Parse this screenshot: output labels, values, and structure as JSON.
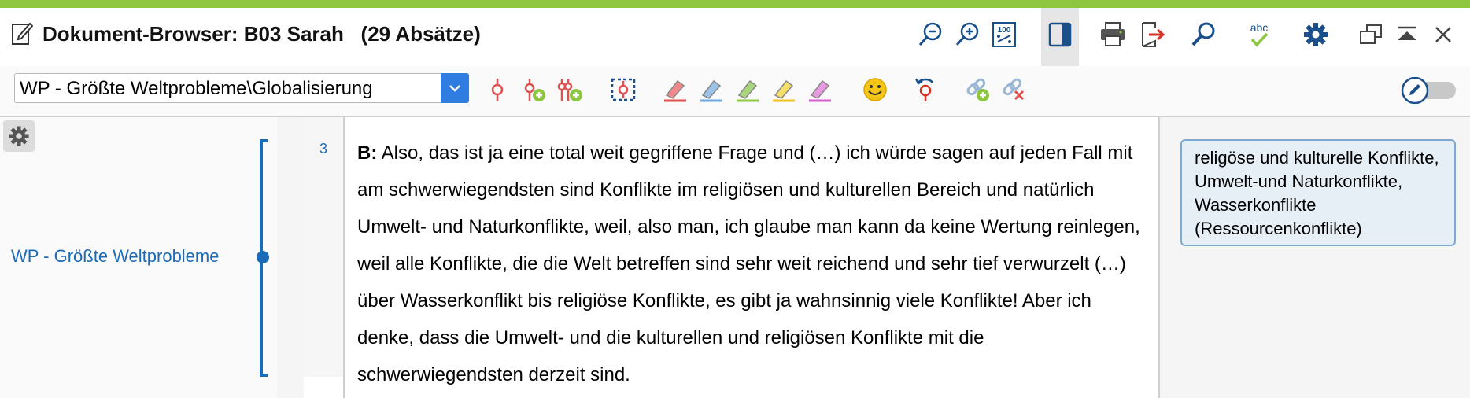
{
  "window": {
    "title": "Dokument-Browser: B03 Sarah   (29 Absätze)"
  },
  "colors": {
    "accent_green": "#8dc63f",
    "code_blue": "#1c6bb8",
    "combo_button_blue": "#2f7de1"
  },
  "titlebar_icons": [
    "zoom-out-icon",
    "zoom-in-icon",
    "zoom-100-icon",
    "panel-toggle-icon",
    "print-icon",
    "export-icon",
    "search-icon",
    "spellcheck-icon",
    "settings-gear-icon",
    "window-restore-icon",
    "collapse-up-icon",
    "close-icon"
  ],
  "toolbar": {
    "code_combo_value": "WP - Größte Weltprobleme\\Globalisierung",
    "icons": [
      "code-segment-icon",
      "code-add-icon",
      "code-multi-add-icon",
      "code-selection-box-icon",
      "red-highlighter-icon",
      "blue-highlighter-icon",
      "green-highlighter-icon",
      "yellow-highlighter-icon",
      "magenta-highlighter-icon",
      "emoji-code-icon",
      "undo-code-icon",
      "link-add-icon",
      "link-remove-icon",
      "edit-mode-toggle-icon"
    ]
  },
  "left_panel": {
    "code_name": "WP - Größte Weltprobleme"
  },
  "document": {
    "line_number": "3",
    "speaker": "B:",
    "text": " Also, das ist ja eine total weit gegriffene Frage und (…) ich würde sagen auf jeden Fall mit am schwerwiegendsten sind Konflikte im religiösen und kulturellen Bereich und natürlich Umwelt- und Naturkonflikte, weil, also man, ich glaube man kann da keine Wertung reinlegen, weil alle Konflikte, die die Welt betreffen sind sehr weit reichend und sehr tief verwurzelt (…) über Wasserkonflikt bis religiöse Konflikte, es gibt ja wahnsinnig viele Konflikte! Aber ich denke, dass die Umwelt- und die kulturellen und religiösen Konflikte mit die schwerwiegendsten derzeit sind."
  },
  "memo": {
    "text": "religöse und kulturelle Konflikte, Umwelt-und Naturkonflikte, Wasserkonflikte (Ressourcenkonflikte)"
  }
}
